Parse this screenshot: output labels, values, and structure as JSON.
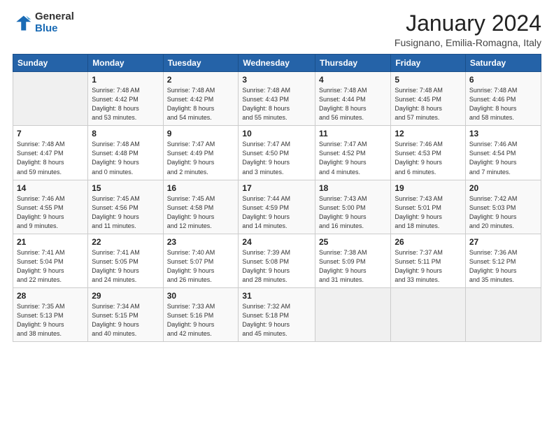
{
  "logo": {
    "general": "General",
    "blue": "Blue"
  },
  "title": "January 2024",
  "subtitle": "Fusignano, Emilia-Romagna, Italy",
  "days_header": [
    "Sunday",
    "Monday",
    "Tuesday",
    "Wednesday",
    "Thursday",
    "Friday",
    "Saturday"
  ],
  "weeks": [
    [
      {
        "day": "",
        "info": ""
      },
      {
        "day": "1",
        "info": "Sunrise: 7:48 AM\nSunset: 4:42 PM\nDaylight: 8 hours\nand 53 minutes."
      },
      {
        "day": "2",
        "info": "Sunrise: 7:48 AM\nSunset: 4:42 PM\nDaylight: 8 hours\nand 54 minutes."
      },
      {
        "day": "3",
        "info": "Sunrise: 7:48 AM\nSunset: 4:43 PM\nDaylight: 8 hours\nand 55 minutes."
      },
      {
        "day": "4",
        "info": "Sunrise: 7:48 AM\nSunset: 4:44 PM\nDaylight: 8 hours\nand 56 minutes."
      },
      {
        "day": "5",
        "info": "Sunrise: 7:48 AM\nSunset: 4:45 PM\nDaylight: 8 hours\nand 57 minutes."
      },
      {
        "day": "6",
        "info": "Sunrise: 7:48 AM\nSunset: 4:46 PM\nDaylight: 8 hours\nand 58 minutes."
      }
    ],
    [
      {
        "day": "7",
        "info": "Sunrise: 7:48 AM\nSunset: 4:47 PM\nDaylight: 8 hours\nand 59 minutes."
      },
      {
        "day": "8",
        "info": "Sunrise: 7:48 AM\nSunset: 4:48 PM\nDaylight: 9 hours\nand 0 minutes."
      },
      {
        "day": "9",
        "info": "Sunrise: 7:47 AM\nSunset: 4:49 PM\nDaylight: 9 hours\nand 2 minutes."
      },
      {
        "day": "10",
        "info": "Sunrise: 7:47 AM\nSunset: 4:50 PM\nDaylight: 9 hours\nand 3 minutes."
      },
      {
        "day": "11",
        "info": "Sunrise: 7:47 AM\nSunset: 4:52 PM\nDaylight: 9 hours\nand 4 minutes."
      },
      {
        "day": "12",
        "info": "Sunrise: 7:46 AM\nSunset: 4:53 PM\nDaylight: 9 hours\nand 6 minutes."
      },
      {
        "day": "13",
        "info": "Sunrise: 7:46 AM\nSunset: 4:54 PM\nDaylight: 9 hours\nand 7 minutes."
      }
    ],
    [
      {
        "day": "14",
        "info": "Sunrise: 7:46 AM\nSunset: 4:55 PM\nDaylight: 9 hours\nand 9 minutes."
      },
      {
        "day": "15",
        "info": "Sunrise: 7:45 AM\nSunset: 4:56 PM\nDaylight: 9 hours\nand 11 minutes."
      },
      {
        "day": "16",
        "info": "Sunrise: 7:45 AM\nSunset: 4:58 PM\nDaylight: 9 hours\nand 12 minutes."
      },
      {
        "day": "17",
        "info": "Sunrise: 7:44 AM\nSunset: 4:59 PM\nDaylight: 9 hours\nand 14 minutes."
      },
      {
        "day": "18",
        "info": "Sunrise: 7:43 AM\nSunset: 5:00 PM\nDaylight: 9 hours\nand 16 minutes."
      },
      {
        "day": "19",
        "info": "Sunrise: 7:43 AM\nSunset: 5:01 PM\nDaylight: 9 hours\nand 18 minutes."
      },
      {
        "day": "20",
        "info": "Sunrise: 7:42 AM\nSunset: 5:03 PM\nDaylight: 9 hours\nand 20 minutes."
      }
    ],
    [
      {
        "day": "21",
        "info": "Sunrise: 7:41 AM\nSunset: 5:04 PM\nDaylight: 9 hours\nand 22 minutes."
      },
      {
        "day": "22",
        "info": "Sunrise: 7:41 AM\nSunset: 5:05 PM\nDaylight: 9 hours\nand 24 minutes."
      },
      {
        "day": "23",
        "info": "Sunrise: 7:40 AM\nSunset: 5:07 PM\nDaylight: 9 hours\nand 26 minutes."
      },
      {
        "day": "24",
        "info": "Sunrise: 7:39 AM\nSunset: 5:08 PM\nDaylight: 9 hours\nand 28 minutes."
      },
      {
        "day": "25",
        "info": "Sunrise: 7:38 AM\nSunset: 5:09 PM\nDaylight: 9 hours\nand 31 minutes."
      },
      {
        "day": "26",
        "info": "Sunrise: 7:37 AM\nSunset: 5:11 PM\nDaylight: 9 hours\nand 33 minutes."
      },
      {
        "day": "27",
        "info": "Sunrise: 7:36 AM\nSunset: 5:12 PM\nDaylight: 9 hours\nand 35 minutes."
      }
    ],
    [
      {
        "day": "28",
        "info": "Sunrise: 7:35 AM\nSunset: 5:13 PM\nDaylight: 9 hours\nand 38 minutes."
      },
      {
        "day": "29",
        "info": "Sunrise: 7:34 AM\nSunset: 5:15 PM\nDaylight: 9 hours\nand 40 minutes."
      },
      {
        "day": "30",
        "info": "Sunrise: 7:33 AM\nSunset: 5:16 PM\nDaylight: 9 hours\nand 42 minutes."
      },
      {
        "day": "31",
        "info": "Sunrise: 7:32 AM\nSunset: 5:18 PM\nDaylight: 9 hours\nand 45 minutes."
      },
      {
        "day": "",
        "info": ""
      },
      {
        "day": "",
        "info": ""
      },
      {
        "day": "",
        "info": ""
      }
    ]
  ]
}
